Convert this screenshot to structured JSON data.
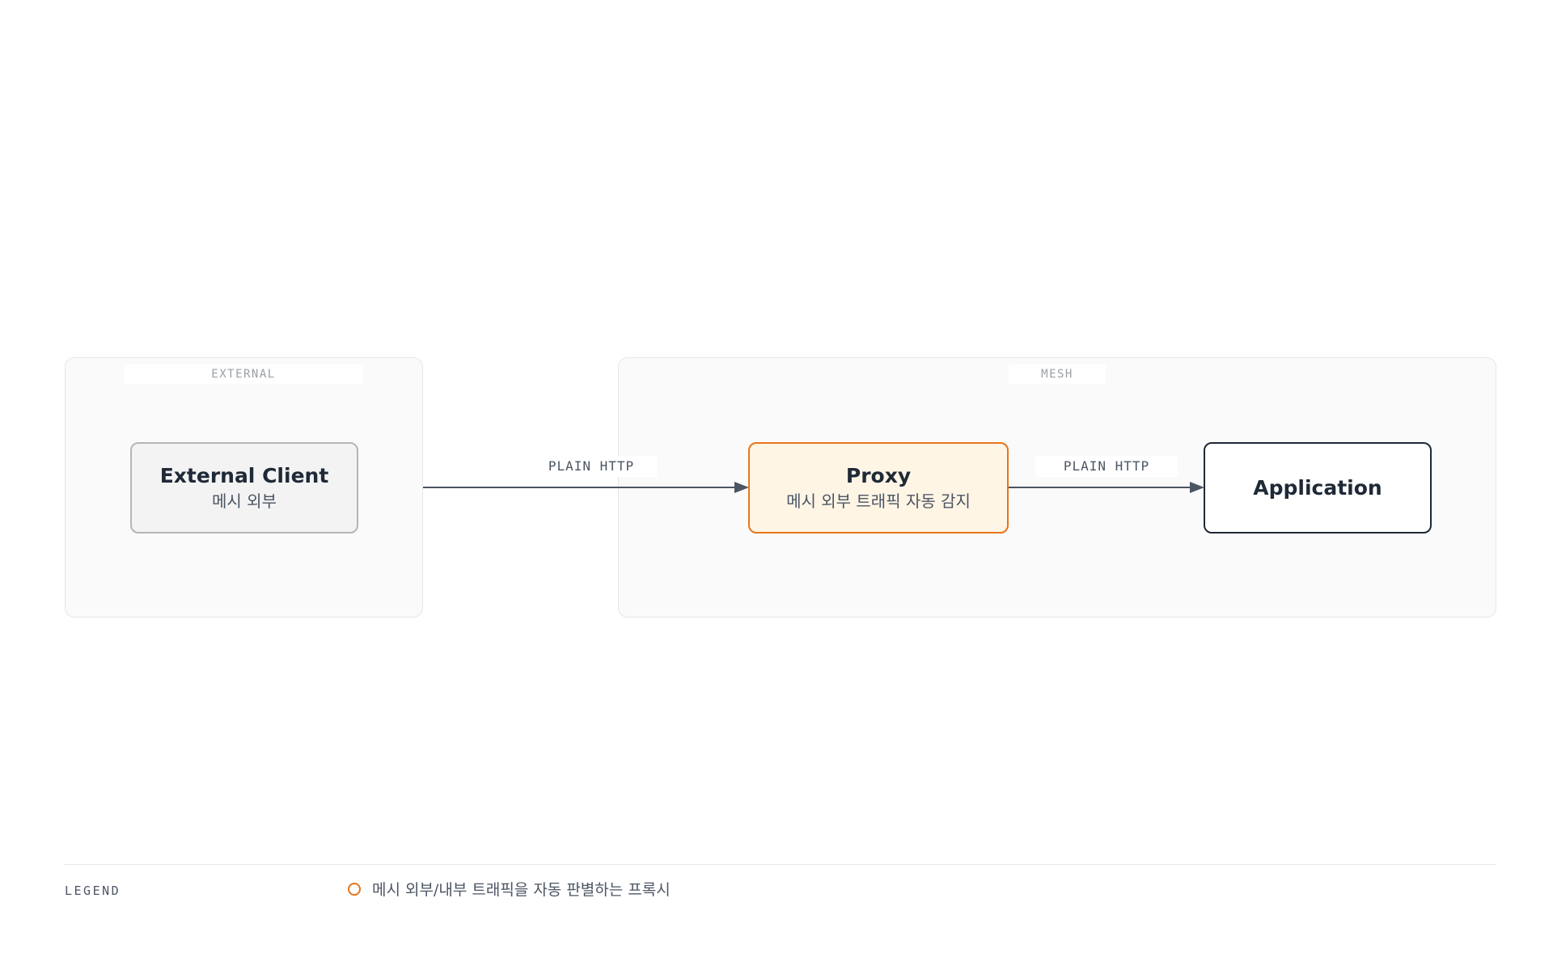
{
  "groups": {
    "external": {
      "label": "EXTERNAL"
    },
    "mesh": {
      "label": "MESH"
    }
  },
  "nodes": {
    "external_client": {
      "title": "External Client",
      "subtitle": "메시 외부"
    },
    "proxy": {
      "title": "Proxy",
      "subtitle": "메시 외부 트래픽 자동 감지"
    },
    "application": {
      "title": "Application"
    }
  },
  "edges": {
    "client_to_proxy": {
      "label": "PLAIN HTTP"
    },
    "proxy_to_app": {
      "label": "PLAIN HTTP"
    }
  },
  "legend": {
    "title": "LEGEND",
    "items": [
      {
        "text": "메시 외부/내부 트래픽을 자동 판별하는 프록시",
        "color": "#e8751a"
      }
    ]
  },
  "colors": {
    "proxy_border": "#e8751a",
    "proxy_fill": "#fff5e5",
    "edge": "#4b5563",
    "app_border": "#1f2937",
    "client_border": "#b5b5b5",
    "client_fill": "#f3f3f3"
  }
}
